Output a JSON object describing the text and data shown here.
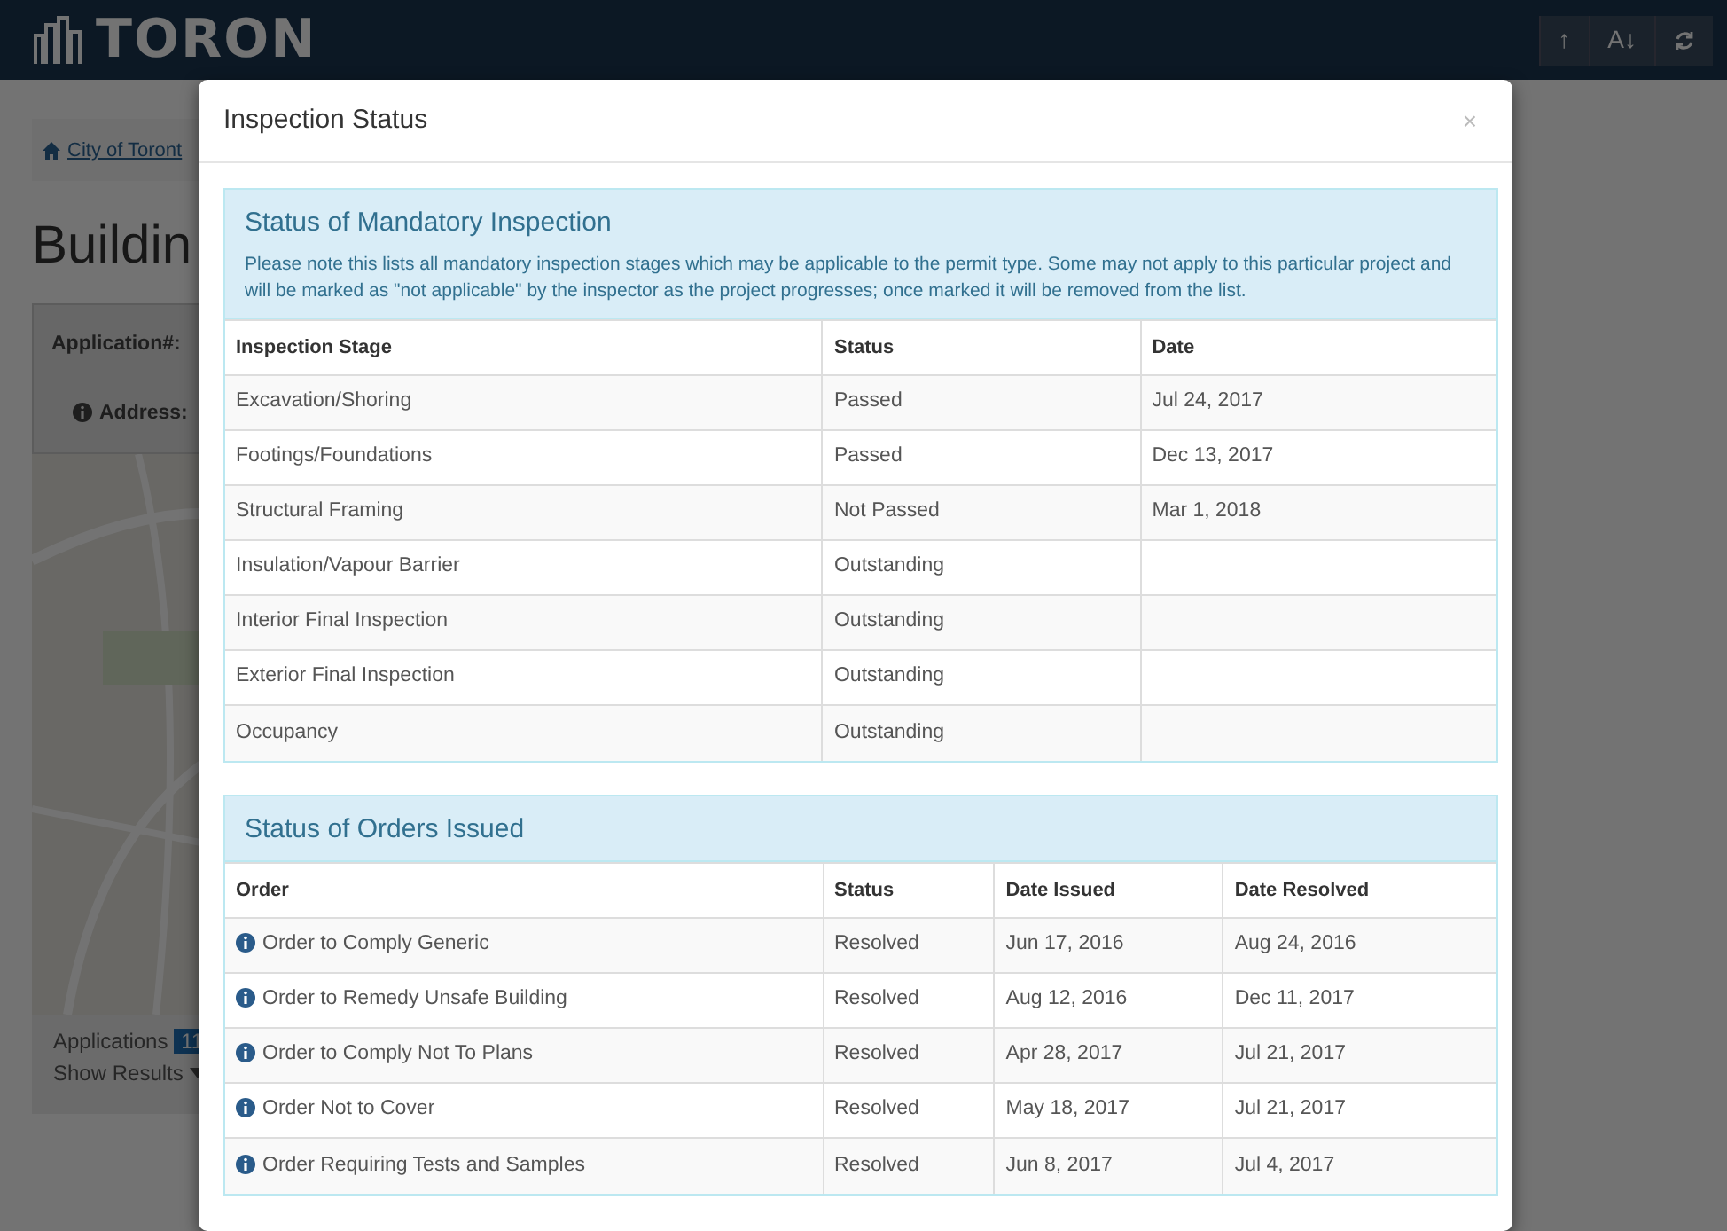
{
  "page": {
    "logo": "TORON",
    "toolbar": [
      {
        "kind": "text",
        "label": "↑"
      },
      {
        "kind": "text",
        "label": "A↓"
      },
      {
        "kind": "refresh"
      }
    ],
    "breadcrumb": "City of Toront",
    "heading": "Buildin",
    "fields": [
      "Application#:",
      "Address:"
    ],
    "applications_label": "Applications",
    "applications_count": "11",
    "show_results": "Show Results"
  },
  "modal": {
    "title": "Inspection Status",
    "close": "×",
    "panels": [
      {
        "title": "Status of Mandatory Inspection",
        "note": "Please note this lists all mandatory inspection stages which may be applicable to the permit type. Some may not apply to this particular project and will be marked as \"not applicable\" by the inspector as the project progresses; once marked it will be removed from the list.",
        "info_icons": false,
        "columns": [
          "Inspection Stage",
          "Status",
          "Date"
        ],
        "rows": [
          [
            "Excavation/Shoring",
            "Passed",
            "Jul 24, 2017"
          ],
          [
            "Footings/Foundations",
            "Passed",
            "Dec 13, 2017"
          ],
          [
            "Structural Framing",
            "Not Passed",
            "Mar 1, 2018"
          ],
          [
            "Insulation/Vapour Barrier",
            "Outstanding",
            ""
          ],
          [
            "Interior Final Inspection",
            "Outstanding",
            ""
          ],
          [
            "Exterior Final Inspection",
            "Outstanding",
            ""
          ],
          [
            "Occupancy",
            "Outstanding",
            ""
          ]
        ]
      },
      {
        "title": "Status of Orders Issued",
        "info_icons": true,
        "columns": [
          "Order",
          "Status",
          "Date Issued",
          "Date Resolved"
        ],
        "rows": [
          [
            "Order to Comply Generic",
            "Resolved",
            "Jun 17, 2016",
            "Aug 24, 2016"
          ],
          [
            "Order to Remedy Unsafe Building",
            "Resolved",
            "Aug 12, 2016",
            "Dec 11, 2017"
          ],
          [
            "Order to Comply Not To Plans",
            "Resolved",
            "Apr 28, 2017",
            "Jul 21, 2017"
          ],
          [
            "Order Not to Cover",
            "Resolved",
            "May 18, 2017",
            "Jul 21, 2017"
          ],
          [
            "Order Requiring Tests and Samples",
            "Resolved",
            "Jun 8, 2017",
            "Jul 4, 2017"
          ]
        ]
      }
    ]
  }
}
